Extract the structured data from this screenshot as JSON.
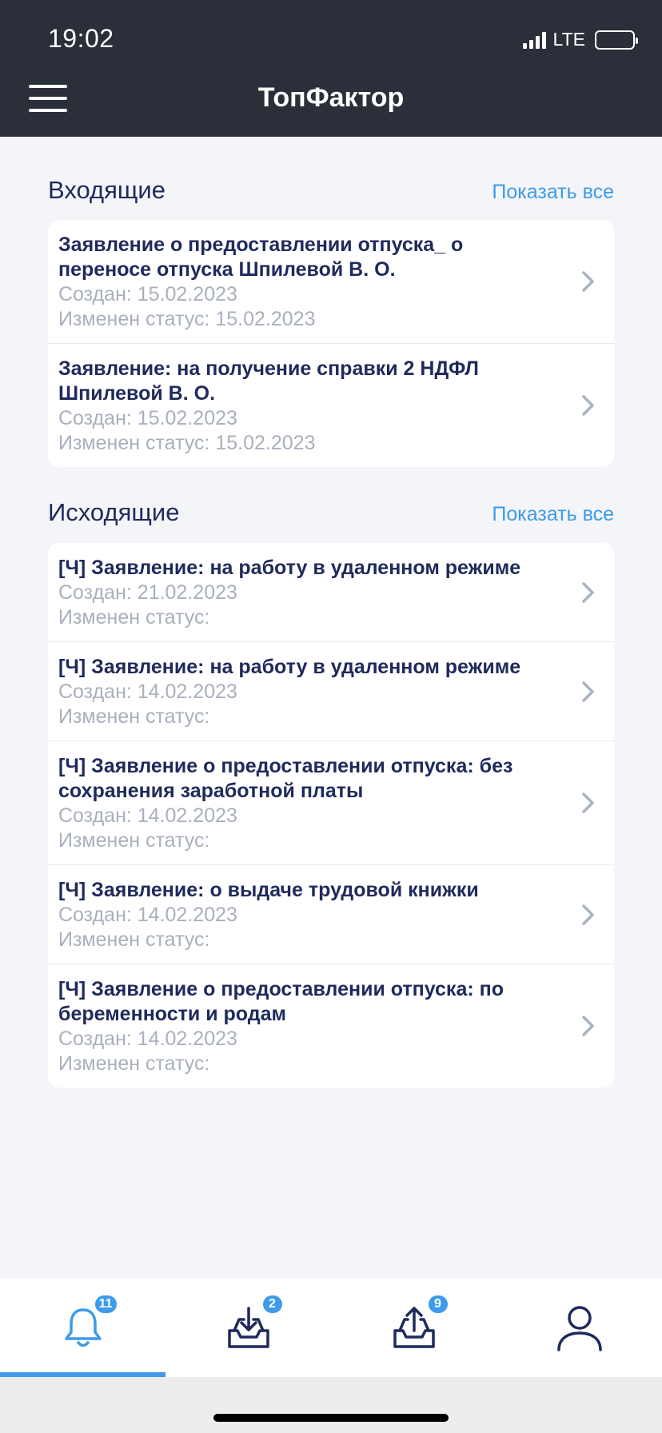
{
  "status_bar": {
    "time": "19:02",
    "network": "LTE"
  },
  "header": {
    "title": "ТопФактор",
    "menu_icon": "hamburger-menu-icon"
  },
  "incoming": {
    "title": "Входящие",
    "show_all": "Показать все",
    "items": [
      {
        "title_lines": [
          "Заявление о предоставлении отпуска_ о",
          "переносе отпуска Шпилевой В. О."
        ],
        "created": "Создан: 15.02.2023",
        "status": "Изменен статус: 15.02.2023"
      },
      {
        "title_lines": [
          "Заявление: на получение справки 2 НДФЛ",
          "Шпилевой В. О."
        ],
        "created": "Создан: 15.02.2023",
        "status": "Изменен статус: 15.02.2023"
      }
    ]
  },
  "outgoing": {
    "title": "Исходящие",
    "show_all": "Показать все",
    "items": [
      {
        "title_lines": [
          "[Ч] Заявление: на работу в удаленном режиме"
        ],
        "created": "Создан: 21.02.2023",
        "status": "Изменен статус:"
      },
      {
        "title_lines": [
          "[Ч] Заявление: на работу в удаленном режиме"
        ],
        "created": "Создан: 14.02.2023",
        "status": "Изменен статус:"
      },
      {
        "title_lines": [
          "[Ч] Заявление о предоставлении отпуска: без",
          "сохранения заработной платы"
        ],
        "created": "Создан: 14.02.2023",
        "status": "Изменен статус:"
      },
      {
        "title_lines": [
          "[Ч] Заявление: о выдаче трудовой книжки"
        ],
        "created": "Создан: 14.02.2023",
        "status": "Изменен статус:"
      },
      {
        "title_lines": [
          "[Ч] Заявление о предоставлении отпуска: по",
          "беременности и родам"
        ],
        "created": "Создан: 14.02.2023",
        "status": "Изменен статус:"
      }
    ]
  },
  "tabbar": {
    "tabs": [
      {
        "icon": "bell-icon",
        "badge": "11",
        "active": true
      },
      {
        "icon": "inbox-download-icon",
        "badge": "2",
        "active": false
      },
      {
        "icon": "outbox-upload-icon",
        "badge": "9",
        "active": false
      },
      {
        "icon": "user-profile-icon",
        "badge": "",
        "active": false
      }
    ]
  },
  "colors": {
    "header_bg": "#2b2f3a",
    "accent": "#3d9be9",
    "title_text": "#1f2a5c",
    "meta_text": "#a9b0bd",
    "page_bg": "#f4f5f9"
  }
}
